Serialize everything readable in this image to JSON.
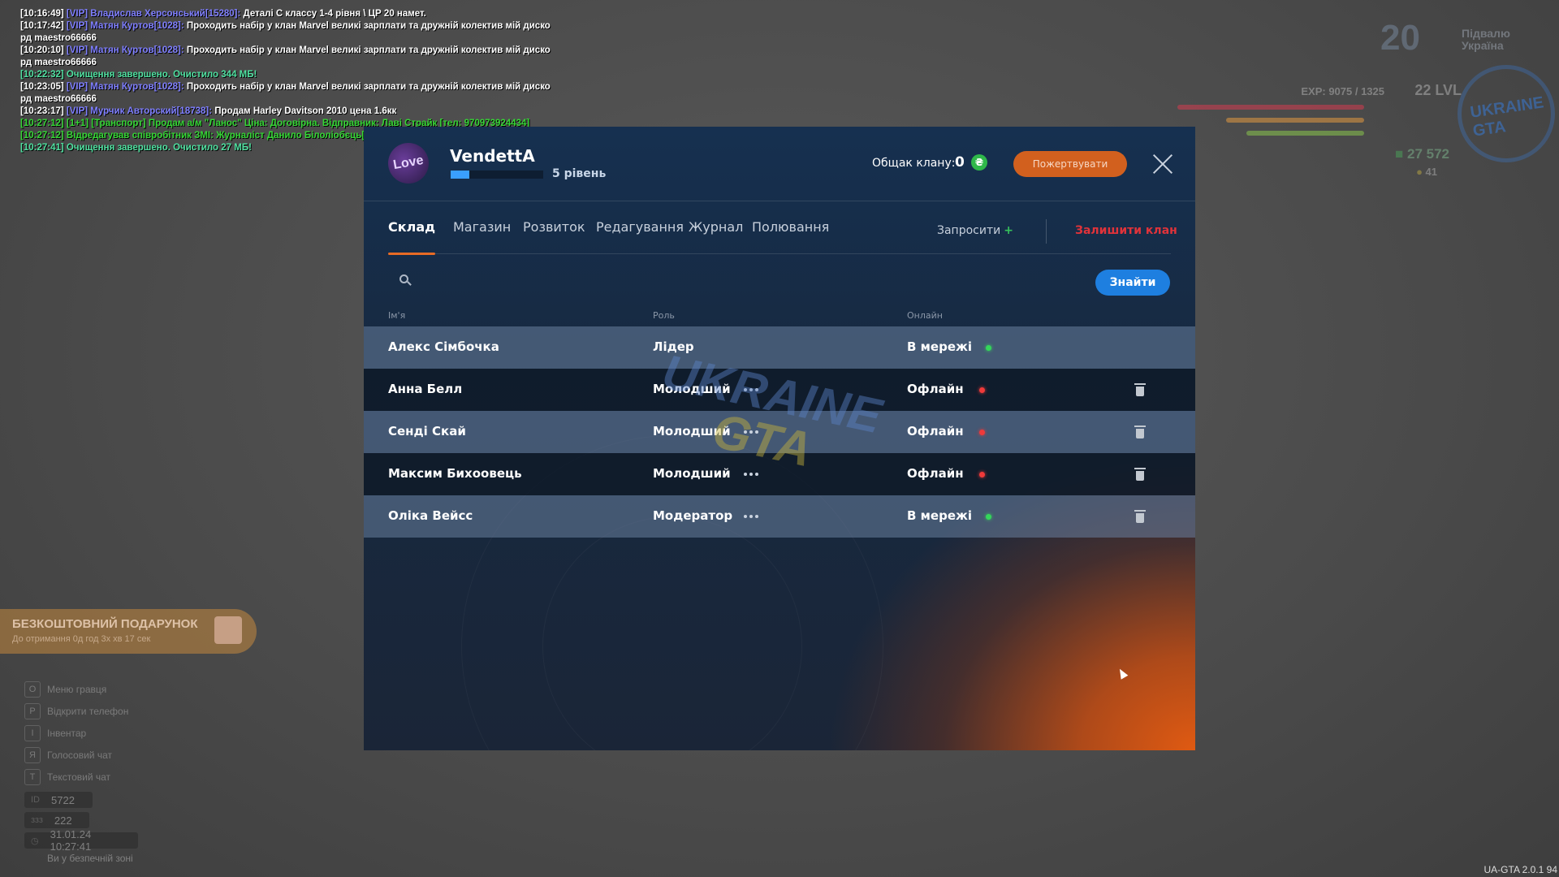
{
  "chat": [
    {
      "time": "[10:16:49]",
      "tag": "[VIP] Владислав Херсонський[15280]:",
      "text": "Деталі C классу 1-4 рівня \\ ЦР 20 намет.",
      "color": "white"
    },
    {
      "time": "[10:17:42]",
      "tag": "[VIP] Матян Куртов[1028]:",
      "text": "Проходить набір у клан Marvel великі зарплати та дружній колектив мій диско",
      "color": "white"
    },
    {
      "time": "",
      "tag": "",
      "text": "рд maestro66666",
      "color": "white"
    },
    {
      "time": "[10:20:10]",
      "tag": "[VIP] Матян Куртов[1028]:",
      "text": "Проходить набір у клан Marvel великі зарплати та дружній колектив мій диско",
      "color": "white"
    },
    {
      "time": "",
      "tag": "",
      "text": "рд maestro66666",
      "color": "white"
    },
    {
      "time": "",
      "tag": "",
      "text": "[10:22:32] Очищення завершено. Очистило 344 МБ!",
      "color": "cyan"
    },
    {
      "time": "[10:23:05]",
      "tag": "[VIP] Матян Куртов[1028]:",
      "text": "Проходить набір у клан Marvel великі зарплати та дружній колектив мій диско",
      "color": "white"
    },
    {
      "time": "",
      "tag": "",
      "text": "рд maestro66666",
      "color": "white"
    },
    {
      "time": "[10:23:17]",
      "tag": "[VIP] Мурчик Авторский[18738]:",
      "text": "Продам Harley Davitson 2010 цена 1.6кк",
      "color": "white"
    },
    {
      "time": "",
      "tag": "",
      "text": "[10:27:12] [1+1] [Транспорт] Продам а/м \"Ланос\" Ціна: Договірна. Відправник: Лаві Страйк [тел: 970973924434]",
      "color": "green"
    },
    {
      "time": "",
      "tag": "",
      "text": "[10:27:12] Відредагував співробітник ЗМІ: Журналіст Данило Білоліобєць[8925]",
      "color": "green"
    },
    {
      "time": "",
      "tag": "",
      "text": "[10:27:41] Очищення завершено. Очистило 27 МБ!",
      "color": "cyan"
    }
  ],
  "hud": {
    "logo_big": "20",
    "logo_small_1": "Підвалю",
    "logo_small_2": "Україна",
    "exp": "EXP: 9075 / 1325",
    "level": "22 LVL",
    "money": "27 572",
    "coins": "41",
    "circle_logo": "UKRAINE GTA"
  },
  "gift": {
    "title": "БЕЗКОШТОВНИЙ ПОДАРУНОК",
    "subtitle": "До отримання 0д год 3х хв 17 сек"
  },
  "hints": [
    {
      "key": "O",
      "label": "Меню гравця"
    },
    {
      "key": "P",
      "label": "Відкрити телефон"
    },
    {
      "key": "I",
      "label": "Інвентар"
    },
    {
      "key": "Я",
      "label": "Голосовий чат"
    },
    {
      "key": "T",
      "label": "Текстовий чат"
    }
  ],
  "info": {
    "id_label": "ID",
    "id_value": "5722",
    "online_label": "ззз",
    "online_value": "222",
    "datetime": "31.01.24 10:27:41",
    "zone": "Ви у безпечній зоні"
  },
  "version": "UA-GTA 2.0.1 94",
  "clan": {
    "logo_text": "Love",
    "name": "VendettA",
    "level_text": "5 рівень",
    "level_progress": 0.2,
    "bank_label": "Общак клану:",
    "bank_value": "0",
    "bank_currency": "₴",
    "donate_label": "Пожертвувати"
  },
  "tabs": [
    {
      "label": "Склад",
      "active": true
    },
    {
      "label": "Магазин",
      "active": false
    },
    {
      "label": "Розвиток",
      "active": false
    },
    {
      "label": "Редагування",
      "active": false
    },
    {
      "label": "Журнал",
      "active": false
    },
    {
      "label": "Полювання",
      "active": false
    }
  ],
  "actions": {
    "invite_label": "Запросити",
    "invite_plus": "+",
    "leave_label": "Залишити клан"
  },
  "search": {
    "placeholder": "",
    "button_label": "Знайти"
  },
  "table": {
    "columns": [
      "Ім'я",
      "Роль",
      "Онлайн"
    ],
    "rows": [
      {
        "name": "Алекс Сімбочка",
        "role": "Лідер",
        "status": "В мережі",
        "online": true,
        "menu": false,
        "delete": false
      },
      {
        "name": "Анна Белл",
        "role": "Молодший",
        "status": "Офлайн",
        "online": false,
        "menu": true,
        "delete": true
      },
      {
        "name": "Сенді Скай",
        "role": "Молодший",
        "status": "Офлайн",
        "online": false,
        "menu": true,
        "delete": true
      },
      {
        "name": "Максим Бихоовець",
        "role": "Молодший",
        "status": "Офлайн",
        "online": false,
        "menu": true,
        "delete": true
      },
      {
        "name": "Оліка Вейсс",
        "role": "Модератор",
        "status": "В мережі",
        "online": true,
        "menu": true,
        "delete": true
      }
    ]
  },
  "watermark": {
    "line1": "UKRAINE",
    "line2": "GTA"
  }
}
